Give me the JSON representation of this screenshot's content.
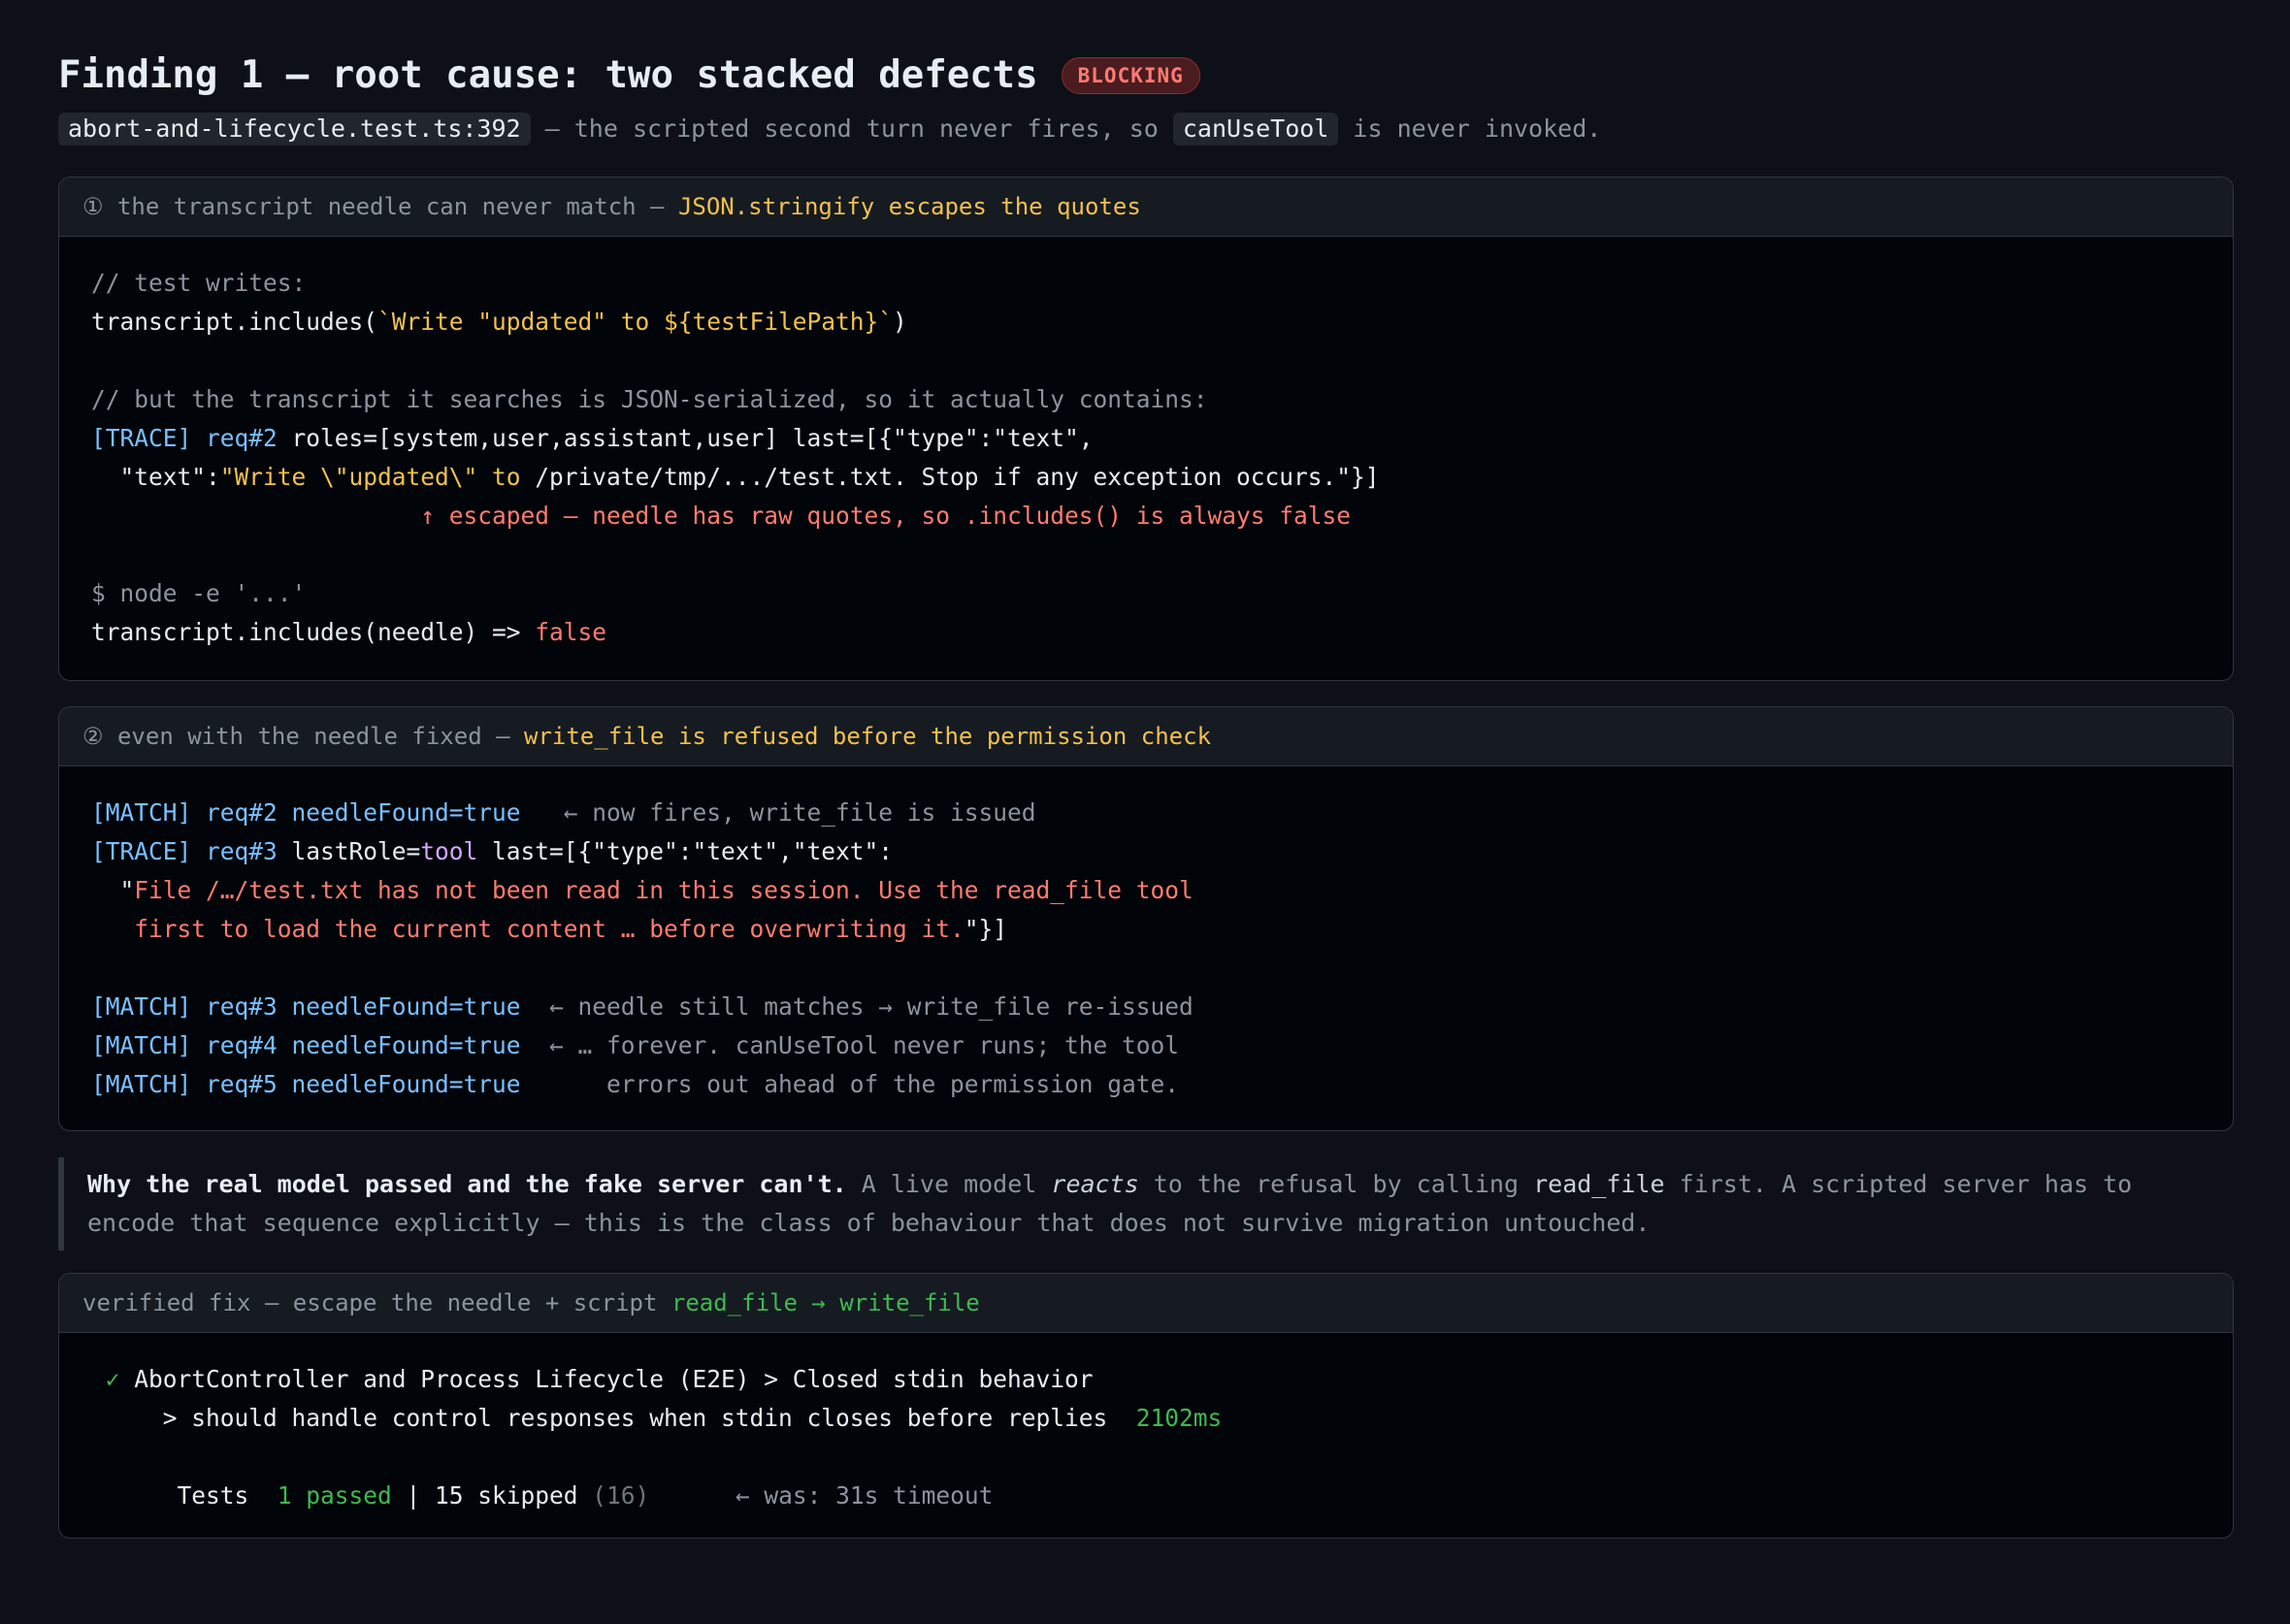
{
  "header": {
    "title": "Finding 1 — root cause: two stacked defects",
    "badge": "BLOCKING",
    "file_ref": "abort-and-lifecycle.test.ts:392",
    "sub_mid": " — the scripted second turn never fires, so ",
    "sub_code": "canUseTool",
    "sub_end": " is never invoked."
  },
  "panel1": {
    "head_prefix": "① the transcript needle can never match — ",
    "head_highlight": "JSON.stringify escapes the quotes",
    "l1": "// test writes:",
    "l2a": "transcript.includes(",
    "l2b": "`Write \"updated\" to ${testFilePath}`",
    "l2c": ")",
    "l3": "// but the transcript it searches is JSON-serialized, so it actually contains:",
    "l4a": "[TRACE] req#2",
    "l4b": " roles=[system,user,assistant,user] last=[{\"type\":\"text\",",
    "l5a": "  \"text\":",
    "l5b": "\"Write \\\"updated\\\" to",
    "l5c": " /private/tmp/.../test.txt. Stop if any exception occurs.\"}]",
    "l6": "                       ↑ escaped — needle has raw quotes, so .includes() is always false",
    "l7": "$ node -e '...'",
    "l8a": "transcript.includes(needle) => ",
    "l8b": "false"
  },
  "panel2": {
    "head_prefix": "② even with the needle fixed — ",
    "head_highlight": "write_file is refused before the permission check",
    "l1a": "[MATCH] req#2 needleFound=true",
    "l1b": "   ← now fires, write_file is issued",
    "l2a": "[TRACE] req#3",
    "l2b": " lastRole=",
    "l2c": "tool",
    "l2d": " last=[{\"type\":\"text\",\"text\":",
    "l3a": "  \"",
    "l3b": "File /…/test.txt has not been read in this session. Use the read_file tool",
    "l4a": "   first to load the current content … before overwriting it.",
    "l4b": "\"}]",
    "l5a": "[MATCH] req#3 needleFound=true",
    "l5b": "  ← needle still matches → write_file re-issued",
    "l6a": "[MATCH] req#4 needleFound=true",
    "l6b": "  ← … forever. canUseTool never runs; the tool",
    "l7a": "[MATCH] req#5 needleFound=true",
    "l7b": "      errors out ahead of the permission gate."
  },
  "note": {
    "bold": "Why the real model passed and the fake server can't.",
    "t1": " A live model ",
    "em": "reacts",
    "t2": " to the refusal by calling ",
    "code": "read_file",
    "t3": " first. A scripted server has to encode that sequence explicitly — this is the class of behaviour that does not survive migration untouched."
  },
  "panel3": {
    "head_prefix": "verified fix — escape the needle + script ",
    "head_highlight": "read_file → write_file",
    "l1a": " ✓",
    "l1b": " AbortController and Process Lifecycle (E2E) > Closed stdin behavior",
    "l2a": "     > should handle control responses when stdin closes before replies  ",
    "l2b": "2102ms",
    "l3a": "      Tests  ",
    "l3b": "1 passed",
    "l3c": " | 15 skipped ",
    "l3d": "(16)",
    "l3e": "      ← was: 31s timeout"
  }
}
